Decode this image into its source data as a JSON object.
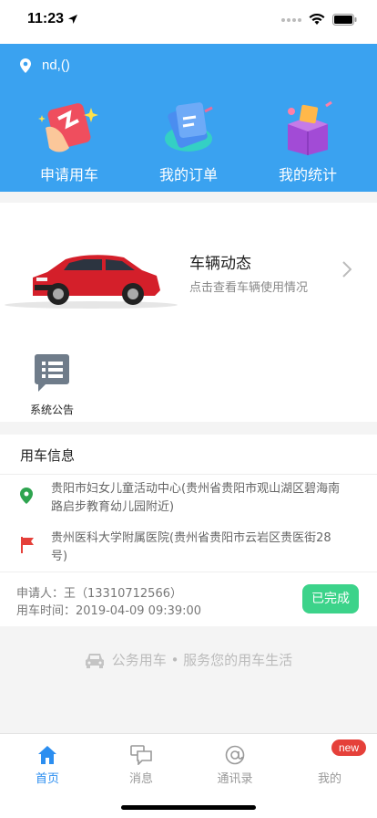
{
  "status": {
    "time": "11:23"
  },
  "header": {
    "location": "nd,()"
  },
  "quick_actions": [
    {
      "label": "申请用车",
      "icon": "apply-car-icon"
    },
    {
      "label": "我的订单",
      "icon": "orders-icon"
    },
    {
      "label": "我的统计",
      "icon": "stats-icon"
    }
  ],
  "vehicle": {
    "title": "车辆动态",
    "subtitle": "点击查看车辆使用情况"
  },
  "notice": {
    "label": "系统公告"
  },
  "usage": {
    "title": "用车信息",
    "start_line1": "贵阳市妇女儿童活动中心(贵州省贵阳市观山湖区碧海南",
    "start_line2": "路启步教育幼儿园附近)",
    "end_line1": "贵州医科大学附属医院(贵州省贵阳市云岩区贵医街28",
    "end_line2": "号)",
    "applicant": "申请人：王（13310712566）",
    "time": "用车时间：2019-04-09 09:39:00",
    "status": "已完成"
  },
  "slogan": "公务用车 • 服务您的用车生活",
  "tabs": [
    {
      "label": "首页",
      "active": true
    },
    {
      "label": "消息",
      "active": false
    },
    {
      "label": "通讯录",
      "active": false
    },
    {
      "label": "我的",
      "active": false,
      "badge": "new"
    }
  ],
  "colors": {
    "primary": "#3aa2f0",
    "success": "#3cd38a",
    "tab_active": "#2b8ef0",
    "badge": "#e5403a"
  }
}
